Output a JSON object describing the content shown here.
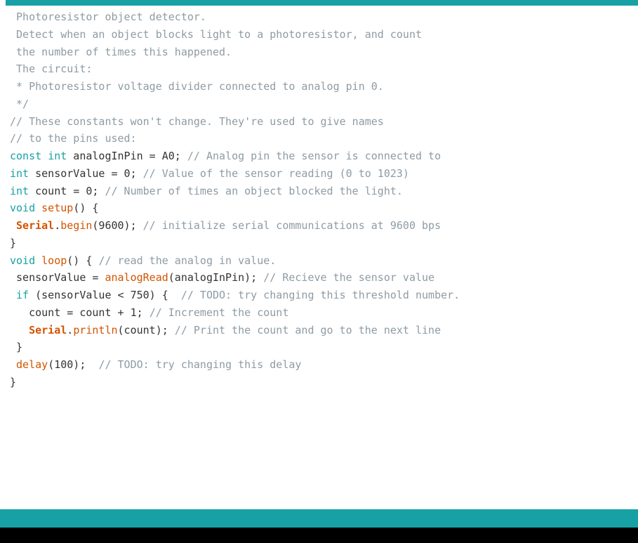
{
  "code": {
    "l1": " Photoresistor object detector.",
    "l2": "",
    "l3": " Detect when an object blocks light to a photoresistor, and count",
    "l4": " the number of times this happened.",
    "l5": "",
    "l6": " The circuit:",
    "l7": " * Photoresistor voltage divider connected to analog pin 0.",
    "l8": "",
    "l9": " */",
    "l10": "",
    "l11": "// These constants won't change. They're used to give names",
    "l12": "// to the pins used:",
    "l13a": "const",
    "l13b": "int",
    "l13c": " analogInPin = A0; ",
    "l13d": "// Analog pin the sensor is connected to",
    "l14a": "int",
    "l14b": " sensorValue = 0; ",
    "l14c": "// Value of the sensor reading (0 to 1023)",
    "l15a": "int",
    "l15b": " count = 0; ",
    "l15c": "// Number of times an object blocked the light.",
    "l16": "",
    "l17a": "void",
    "l17b": "setup",
    "l17c": "() {",
    "l18a": " ",
    "l18b": "Serial",
    "l18c": ".",
    "l18d": "begin",
    "l18e": "(9600); ",
    "l18f": "// initialize serial communications at 9600 bps",
    "l19": "}",
    "l20": "",
    "l21a": "void",
    "l21b": "loop",
    "l21c": "() { ",
    "l21d": "// read the analog in value.",
    "l22a": " sensorValue = ",
    "l22b": "analogRead",
    "l22c": "(analogInPin); ",
    "l22d": "// Recieve the sensor value",
    "l23": "",
    "l24a": " ",
    "l24b": "if",
    "l24c": " (sensorValue < 750) {  ",
    "l24d": "// TODO: try changing this threshold number.",
    "l25a": "   count = count + 1; ",
    "l25b": "// Increment the count",
    "l26a": "   ",
    "l26b": "Serial",
    "l26c": ".",
    "l26d": "println",
    "l26e": "(count); ",
    "l26f": "// Print the count and go to the next line",
    "l27": " }",
    "l28a": " ",
    "l28b": "delay",
    "l28c": "(100);  ",
    "l28d": "// TODO: try changing this delay",
    "l29": "}"
  }
}
